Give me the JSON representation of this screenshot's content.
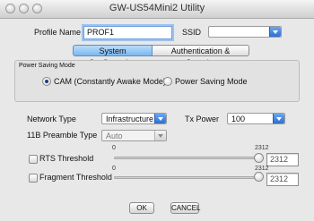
{
  "window": {
    "title": "GW-US54Mini2 Utility"
  },
  "profile": {
    "label": "Profile Name",
    "value": "PROF1",
    "ssid_label": "SSID",
    "ssid_value": ""
  },
  "tabs": [
    "System Configuration",
    "Authentication & Security"
  ],
  "power_saving": {
    "group_label": "Power Saving Mode",
    "options": [
      "CAM (Constantly Awake Mode)",
      "Power Saving Mode"
    ],
    "selected": 0
  },
  "network_type": {
    "label": "Network Type",
    "value": "Infrastructure"
  },
  "tx_power": {
    "label": "Tx Power",
    "value": "100"
  },
  "preamble": {
    "label": "11B Preamble Type",
    "value": "Auto"
  },
  "rts": {
    "label": "RTS Threshold",
    "min": "0",
    "max": "2312",
    "value": "2312"
  },
  "fragment": {
    "label": "Fragment Threshold",
    "min": "0",
    "max": "2312",
    "value": "2312"
  },
  "buttons": {
    "ok": "OK",
    "cancel": "CANCEL"
  }
}
